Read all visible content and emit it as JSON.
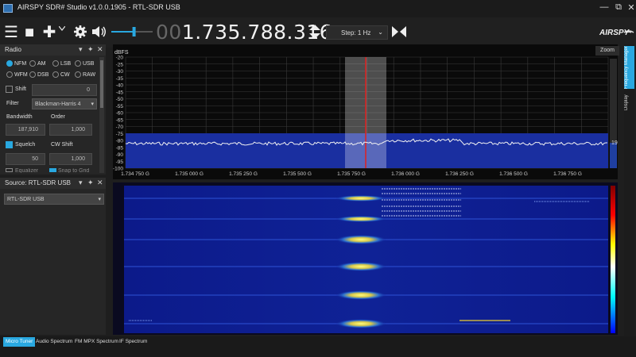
{
  "window": {
    "title": "AIRSPY SDR# Studio v1.0.0.1905 - RTL-SDR USB",
    "minimize": "—",
    "maximize": "⧉",
    "close": "✕"
  },
  "toolbar": {
    "menu_icon": "☰",
    "stop_icon": "■",
    "add_icon": "✚",
    "settings_icon": "gear-icon",
    "volume_icon": "speaker-icon",
    "frequency_prefix": "00",
    "frequency": "1.735.788.316",
    "step_label": "Step: 1 Hz",
    "brand": "AIRSPY",
    "volume_level": 0.55
  },
  "radio_panel": {
    "title": "Radio",
    "modes": [
      {
        "label": "NFM",
        "selected": true
      },
      {
        "label": "AM",
        "selected": false
      },
      {
        "label": "LSB",
        "selected": false
      },
      {
        "label": "USB",
        "selected": false
      },
      {
        "label": "WFM",
        "selected": false
      },
      {
        "label": "DSB",
        "selected": false
      },
      {
        "label": "CW",
        "selected": false
      },
      {
        "label": "RAW",
        "selected": false
      }
    ],
    "shift_label": "Shift",
    "shift_value": "0",
    "filter_label": "Filter",
    "filter_value": "Blackman-Harris 4",
    "bandwidth_label": "Bandwidth",
    "bandwidth_value": "187,910",
    "order_label": "Order",
    "order_value": "1,000",
    "squelch_label": "Squelch",
    "squelch_value": "50",
    "cw_shift_label": "CW Shift",
    "cw_shift_value": "1,000",
    "equalizer_label": "Equalizer",
    "snap_label": "Snap to Grid"
  },
  "source_panel": {
    "title": "Source: RTL-SDR USB",
    "device": "RTL-SDR USB"
  },
  "spectrum": {
    "ylabel": "dBFS",
    "y_ticks": [
      "-20",
      "-25",
      "-30",
      "-35",
      "-40",
      "-45",
      "-50",
      "-55",
      "-60",
      "-65",
      "-70",
      "-75",
      "-80",
      "-85",
      "-90",
      "-95",
      "-100"
    ],
    "x_ticks": [
      "1.734 750 G",
      "1.735 000 G",
      "1.735 250 G",
      "1.735 500 G",
      "1.735 750 G",
      "1.736 000 G",
      "1.736 250 G",
      "1.736 500 G",
      "1.736 750 G"
    ],
    "zoom_label": "Zoom",
    "level_value": "19"
  },
  "side_tabs": [
    "Frequency Manager",
    "Display"
  ],
  "bottom_tabs": [
    {
      "label": "Micro Tuner",
      "active": true
    },
    {
      "label": "Audio Spectrum",
      "active": false
    },
    {
      "label": "FM MPX Spectrum",
      "active": false
    },
    {
      "label": "IF Spectrum",
      "active": false
    }
  ],
  "colors": {
    "accent": "#29a8e0",
    "tuned_marker": "#e02020",
    "noise_floor": "#1a2fa0"
  }
}
